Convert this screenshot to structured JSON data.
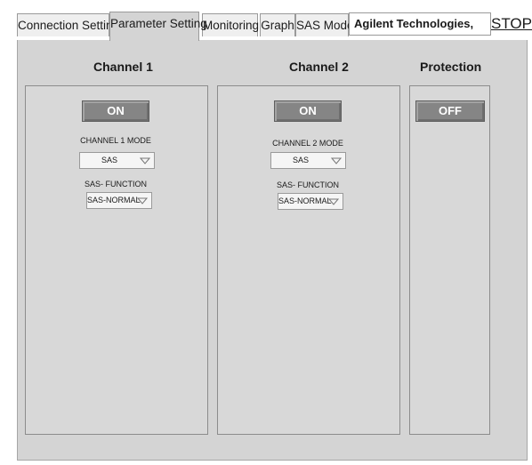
{
  "tabs": [
    {
      "label": "Connection Setting"
    },
    {
      "label": "Parameter Setting"
    },
    {
      "label": "Monitoring"
    },
    {
      "label": "Graph"
    },
    {
      "label": "SAS Model"
    }
  ],
  "header": {
    "vendor": "Agilent Technologies,",
    "stop_label": "STOP"
  },
  "channel1": {
    "title": "Channel 1",
    "output_button": "ON",
    "mode_label": "CHANNEL 1 MODE",
    "mode_value": "SAS",
    "function_label": "SAS- FUNCTION",
    "function_value": "SAS-NORMAL"
  },
  "channel2": {
    "title": "Channel 2",
    "output_button": "ON",
    "mode_label": "CHANNEL 2 MODE",
    "mode_value": "SAS",
    "function_label": "SAS- FUNCTION",
    "function_value": "SAS-NORMAL"
  },
  "protection": {
    "title": "Protection",
    "button": "OFF"
  },
  "icons": {
    "dropdown": "triangle-down-icon"
  }
}
